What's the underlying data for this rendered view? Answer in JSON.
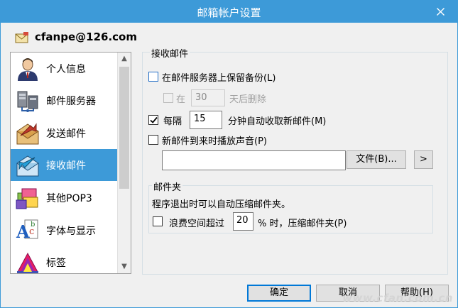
{
  "window": {
    "title": "邮箱帐户设置",
    "accent_color": "#3d9ad8"
  },
  "account": {
    "email": "cfanpe@126.com",
    "icon": "envelope-icon"
  },
  "sidebar": {
    "items": [
      {
        "label": "个人信息",
        "icon": "person-icon",
        "selected": false
      },
      {
        "label": "邮件服务器",
        "icon": "server-icon",
        "selected": false
      },
      {
        "label": "发送邮件",
        "icon": "send-mail-icon",
        "selected": false
      },
      {
        "label": "接收邮件",
        "icon": "receive-mail-icon",
        "selected": true
      },
      {
        "label": "其他POP3",
        "icon": "pop3-icon",
        "selected": false
      },
      {
        "label": "字体与显示",
        "icon": "font-icon",
        "selected": false
      },
      {
        "label": "标签",
        "icon": "tag-icon",
        "selected": false
      }
    ]
  },
  "receive": {
    "group_title": "接收邮件",
    "keep_backup_label": "在邮件服务器上保留备份(L)",
    "keep_backup_checked": false,
    "delete_prefix": "在",
    "delete_days": "30",
    "delete_suffix": "天后删除",
    "delete_checked": false,
    "every_label": "每隔",
    "every_checked": true,
    "every_minutes": "15",
    "every_suffix": "分钟自动收取新邮件(M)",
    "sound_label": "新邮件到来时播放声音(P)",
    "sound_checked": false,
    "sound_path": "",
    "file_button": "文件(B)...",
    "play_button": ">"
  },
  "folder": {
    "group_title": "邮件夹",
    "description": "程序退出时可以自动压缩邮件夹。",
    "waste_label": "浪费空间超过",
    "waste_checked": false,
    "waste_percent": "20",
    "waste_suffix": "% 时，压缩邮件夹(P)"
  },
  "buttons": {
    "ok": "确定",
    "cancel": "取消",
    "help": "帮助(H)"
  },
  "watermark": "www.cfan.com.cn"
}
